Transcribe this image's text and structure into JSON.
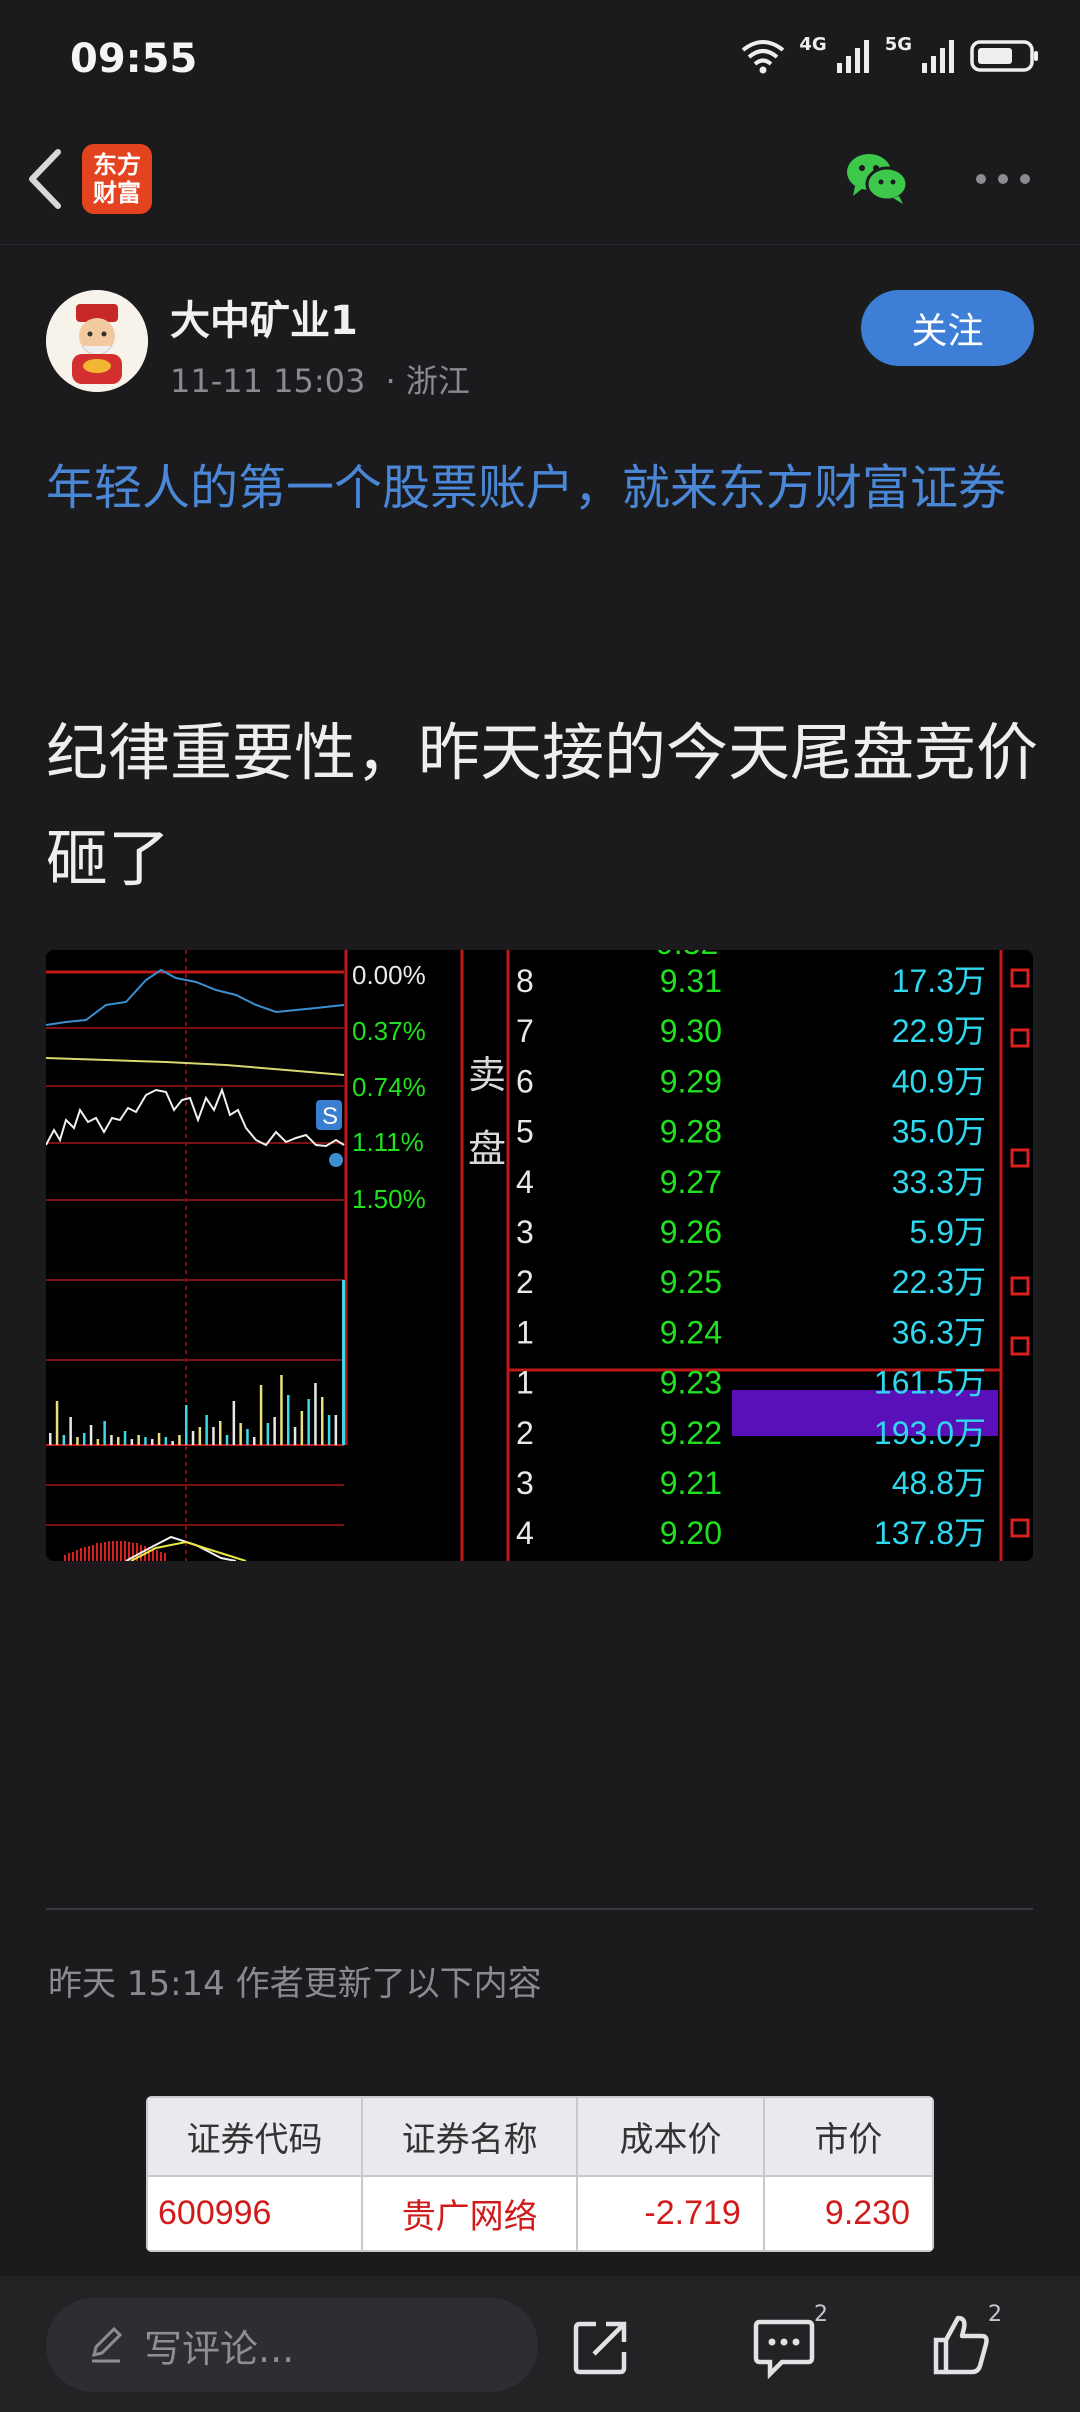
{
  "status_bar": {
    "time": "09:55",
    "network_1": "4G",
    "network_2": "5G",
    "icons": [
      "wifi-icon",
      "signal-4g-icon",
      "signal-5g-icon",
      "battery-icon"
    ]
  },
  "app_bar": {
    "logo_line1": "东方",
    "logo_line2": "财富",
    "icons": [
      "back-icon",
      "wechat-share-icon",
      "more-icon"
    ]
  },
  "post": {
    "author_name": "大中矿业1",
    "timestamp": "11-11 15:03",
    "location": "· 浙江",
    "follow_label": "关注",
    "ad_link": "年轻人的第一个股票账户，就来东方财富证券",
    "body": "纪律重要性，昨天接的今天尾盘竞价砸了"
  },
  "quote_image": {
    "percent_labels": [
      "0.00%",
      "0.37%",
      "0.74%",
      "1.11%",
      "1.50%"
    ],
    "marker_label": "S",
    "sell_label_1": "卖",
    "sell_label_2": "盘",
    "sell_rows": [
      {
        "level": "8",
        "price": "9.31",
        "volume": "17.3万"
      },
      {
        "level": "7",
        "price": "9.30",
        "volume": "22.9万"
      },
      {
        "level": "6",
        "price": "9.29",
        "volume": "40.9万"
      },
      {
        "level": "5",
        "price": "9.28",
        "volume": "35.0万"
      },
      {
        "level": "4",
        "price": "9.27",
        "volume": "33.3万"
      },
      {
        "level": "3",
        "price": "9.26",
        "volume": "5.9万"
      },
      {
        "level": "2",
        "price": "9.25",
        "volume": "22.3万"
      },
      {
        "level": "1",
        "price": "9.24",
        "volume": "36.3万"
      }
    ],
    "buy_rows": [
      {
        "level": "1",
        "price": "9.23",
        "volume": "161.5万"
      },
      {
        "level": "2",
        "price": "9.22",
        "volume": "193.0万"
      },
      {
        "level": "3",
        "price": "9.21",
        "volume": "48.8万"
      },
      {
        "level": "4",
        "price": "9.20",
        "volume": "137.8万"
      }
    ]
  },
  "update": {
    "note": "昨天 15:14  作者更新了以下内容"
  },
  "holding_table": {
    "headers": [
      "证券代码",
      "证券名称",
      "成本价",
      "市价"
    ],
    "row": [
      "600996",
      "贵广网络",
      "-2.719",
      "9.230"
    ]
  },
  "bottom_bar": {
    "comment_placeholder": "写评论...",
    "comment_count": "2",
    "like_count": "2"
  },
  "colors": {
    "background": "#1b1b1e",
    "link_blue": "#4a87d6",
    "follow_blue": "#3d7fd6",
    "logo_orange": "#e3431f",
    "quote_green": "#20e020",
    "quote_cyan": "#2fd8f0",
    "quote_red": "#c01818",
    "highlight_purple": "#5a10b8"
  }
}
